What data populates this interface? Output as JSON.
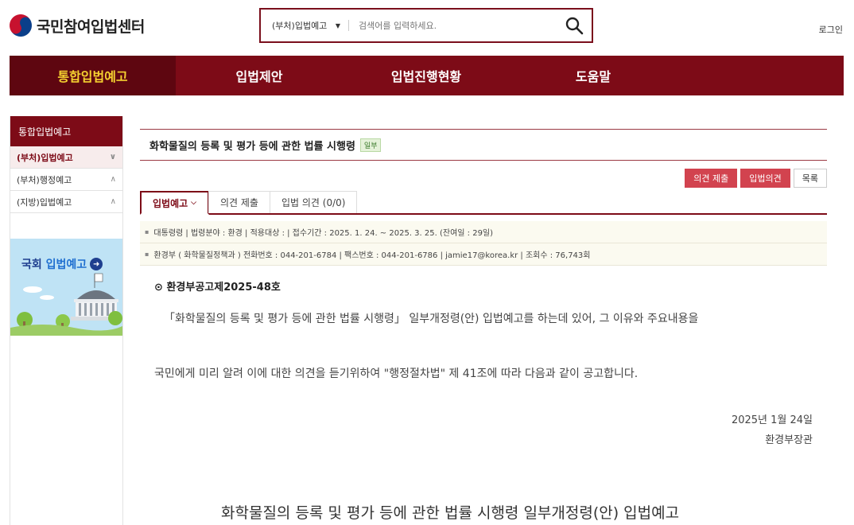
{
  "header": {
    "site_name": "국민참여입법센터",
    "login": "로그인",
    "search": {
      "category": "(부처)입법예고",
      "placeholder": "검색어를 입력하세요."
    }
  },
  "gnb": {
    "items": [
      {
        "label": "통합입법예고"
      },
      {
        "label": "입법제안"
      },
      {
        "label": "입법진행현황"
      },
      {
        "label": "도움말"
      }
    ],
    "colors": {
      "bar": "#7d0b17",
      "active_text": "#f5d130"
    }
  },
  "sidebar": {
    "title": "통합입법예고",
    "items": [
      {
        "label": "(부처)입법예고"
      },
      {
        "label": "(부처)행정예고"
      },
      {
        "label": "(지방)입법예고"
      }
    ],
    "banner": {
      "prefix": "국회",
      "highlight": "입법예고"
    }
  },
  "detail": {
    "title": "화학물질의 등록 및 평가 등에 관한 법률 시행령",
    "badge": "일부",
    "actions": {
      "submit": "의견 제출",
      "opinions": "입법의견",
      "list": "목록"
    },
    "tabs": [
      {
        "label": "입법예고"
      },
      {
        "label": "의견 제출"
      },
      {
        "label": "입법 의견 (0/0)"
      }
    ],
    "info": {
      "row1": "대통령령 | 법령분야 : 환경 | 적용대상 : | 접수기간 : 2025. 1. 24. ~ 2025. 3. 25. (잔여일 : 29일)",
      "row2": "환경부 ( 화학물질정책과 )   전화번호 : 044-201-6784 | 팩스번호 : 044-201-6786 | jamie17@korea.kr | 조회수 : 76,743회"
    },
    "notice_number": "환경부공고제2025-48호",
    "paragraph1": "「화학물질의 등록 및 평가 등에 관한 법률 시행령」 일부개정령(안) 입법예고를 하는데 있어, 그 이유와 주요내용을",
    "paragraph2": "국민에게 미리 알려 이에 대한 의견을 듣기위하여 \"행정절차법\" 제 41조에 따라 다음과 같이 공고합니다.",
    "date": "2025년 1월 24일",
    "minister": "환경부장관",
    "doc_heading": "화학물질의 등록 및 평가 등에 관한 법률 시행령 일부개정령(안) 입법예고"
  }
}
